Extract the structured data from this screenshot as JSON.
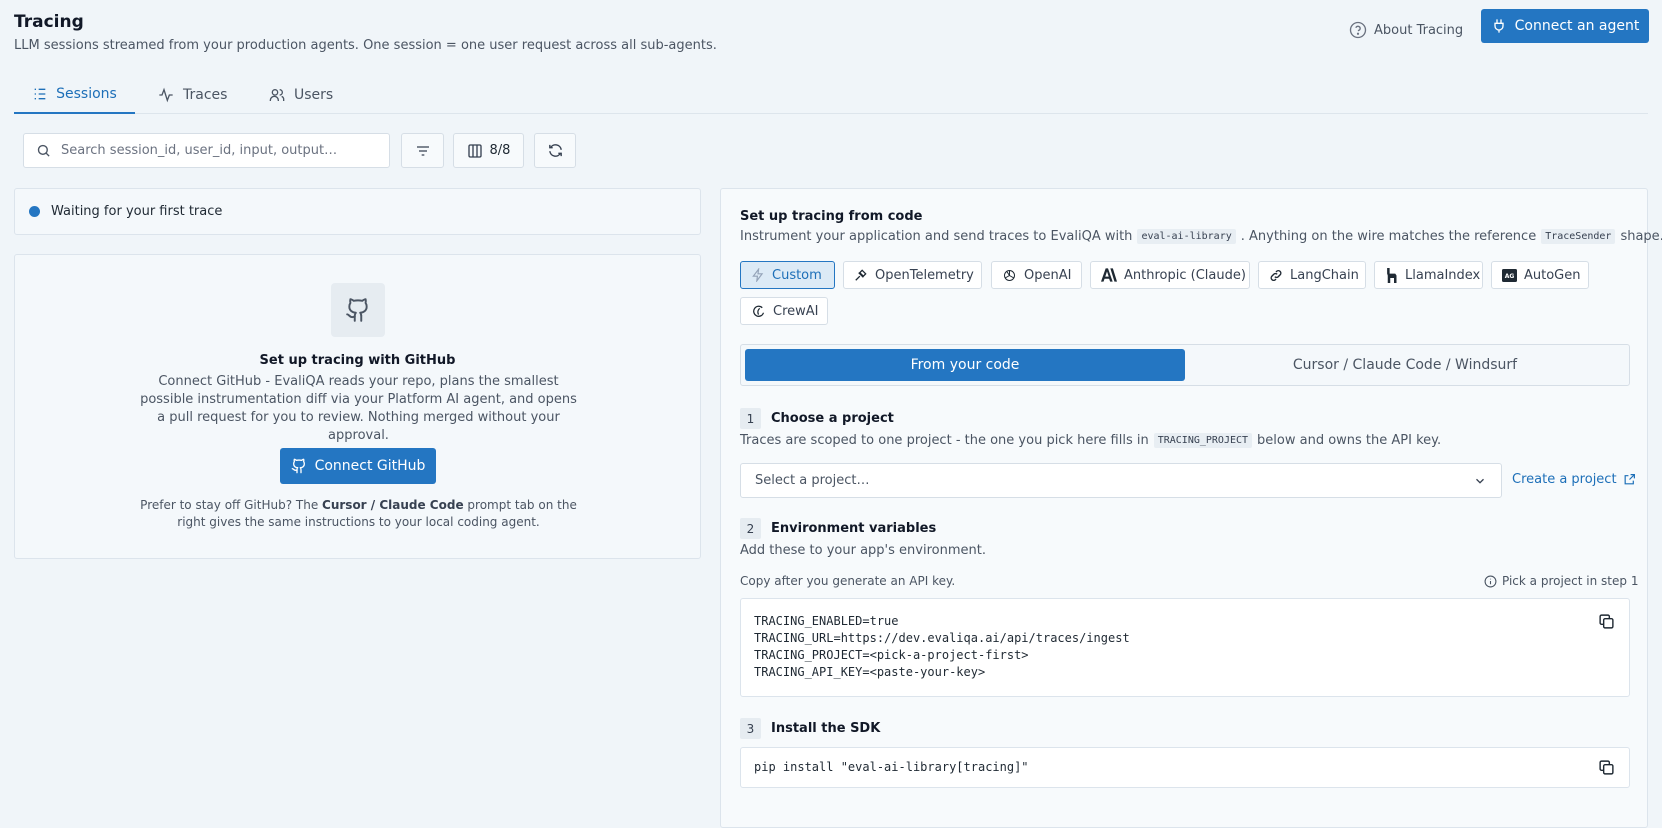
{
  "header": {
    "title": "Tracing",
    "subtitle": "LLM sessions streamed from your production agents. One session = one user request across all sub-agents.",
    "about_label": "About Tracing",
    "connect_agent_label": "Connect an agent"
  },
  "tabs": [
    {
      "label": "Sessions",
      "icon": "list-icon",
      "active": true
    },
    {
      "label": "Traces",
      "icon": "activity-icon",
      "active": false
    },
    {
      "label": "Users",
      "icon": "users-icon",
      "active": false
    }
  ],
  "toolbar": {
    "search_placeholder": "Search session_id, user_id, input, output…",
    "columns_label": "8/8"
  },
  "status": {
    "text": "Waiting for your first trace"
  },
  "github_card": {
    "title": "Set up tracing with GitHub",
    "description": "Connect GitHub - EvaliQA reads your repo, plans the smallest possible instrumentation diff via your Platform AI agent, and opens a pull request for you to review. Nothing merged without your approval.",
    "button_label": "Connect GitHub",
    "footer_pre": "Prefer to stay off GitHub? The",
    "footer_bold": "Cursor / Claude Code",
    "footer_post": "prompt tab on the right gives the same instructions to your local coding agent."
  },
  "setup": {
    "title": "Set up tracing from code",
    "subtitle_pre": "Instrument your application and send traces to EvaliQA with",
    "subtitle_code": "eval-ai-library",
    "subtitle_mid": ". Anything on the wire matches the reference",
    "subtitle_code2": "TraceSender",
    "subtitle_post": "shape.",
    "frameworks": [
      {
        "label": "Custom",
        "icon": "bolt-icon",
        "active": true
      },
      {
        "label": "OpenTelemetry",
        "icon": "telescope-icon",
        "active": false
      },
      {
        "label": "OpenAI",
        "icon": "openai-icon",
        "active": false
      },
      {
        "label": "Anthropic (Claude)",
        "icon": "anthropic-icon",
        "active": false
      },
      {
        "label": "LangChain",
        "icon": "langchain-icon",
        "active": false
      },
      {
        "label": "LlamaIndex",
        "icon": "llamaindex-icon",
        "active": false
      },
      {
        "label": "AutoGen",
        "icon": "autogen-icon",
        "active": false
      },
      {
        "label": "CrewAI",
        "icon": "crewai-icon",
        "active": false
      }
    ],
    "modes": [
      {
        "label": "From your code",
        "active": true
      },
      {
        "label": "Cursor / Claude Code / Windsurf",
        "active": false
      }
    ],
    "step1": {
      "num": "1",
      "title": "Choose a project",
      "desc_pre": "Traces are scoped to one project - the one you pick here fills in",
      "desc_code": "TRACING_PROJECT",
      "desc_post": "below and owns the API key.",
      "select_placeholder": "Select a project…",
      "create_label": "Create a project"
    },
    "step2": {
      "num": "2",
      "title": "Environment variables",
      "desc": "Add these to your app's environment.",
      "note": "Copy after you generate an API key.",
      "hint": "Pick a project in step 1",
      "env_lines": [
        "TRACING_ENABLED=true",
        "TRACING_URL=https://dev.evaliqa.ai/api/traces/ingest",
        "TRACING_PROJECT=<pick-a-project-first>",
        "TRACING_API_KEY=<paste-your-key>"
      ]
    },
    "step3": {
      "num": "3",
      "title": "Install the SDK",
      "command": "pip install \"eval-ai-library[tracing]\""
    }
  },
  "colors": {
    "accent": "#2476c2",
    "background": "#f0f5f9",
    "status_dot": "#2476c2"
  }
}
